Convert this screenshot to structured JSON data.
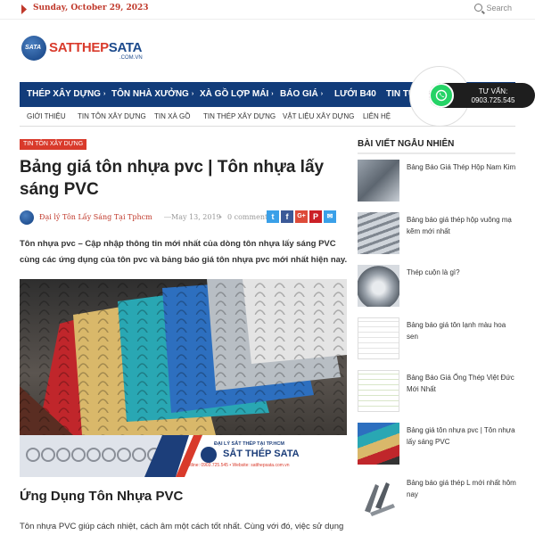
{
  "topbar": {
    "date": "Sunday, October 29, 2023",
    "search_label": "Search"
  },
  "logo": {
    "brand_red": "SATTHEP",
    "brand_blue": "SATA",
    "domain": ".COM.VN",
    "badge": "SATA"
  },
  "nav": {
    "items": [
      {
        "label": "THÉP XÂY DỰNG",
        "chevron": "›"
      },
      {
        "label": "TÔN NHÀ XƯỞNG",
        "chevron": "›"
      },
      {
        "label": "XÀ GỒ LỢP MÁI",
        "chevron": "›"
      },
      {
        "label": "BÁO GIÁ",
        "chevron": "›"
      },
      {
        "label": "LƯỚI B40",
        "chevron": ""
      },
      {
        "label": "TIN TỨC",
        "chevron": "›"
      }
    ],
    "bg_color": "#123c7a"
  },
  "whatsapp": {
    "line1": "TƯ VẤN:",
    "line2": "0903.725.545"
  },
  "subnav": {
    "items": [
      "GIỚI THIỆU",
      "TIN TÔN XÂY DỰNG",
      "TIN XÀ GỒ",
      "TIN THÉP XÂY DỰNG",
      "VẬT LIỆU XÂY DỰNG",
      "LIÊN HỆ"
    ]
  },
  "article": {
    "category": "TIN TÔN XÂY DỰNG",
    "title": "Bảng giá tôn nhựa pvc | Tôn nhựa lấy sáng PVC",
    "author": "Đại lý Tôn Lấy Sáng Tại Tphcm",
    "date": "May 13, 2019",
    "comments": "0 comment",
    "share_icons": [
      "twitter-icon",
      "facebook-icon",
      "googleplus-icon",
      "pinterest-icon",
      "email-icon"
    ],
    "lead": "Tôn nhựa pvc – Cập nhập thông tin mới nhất của dòng tôn nhựa lấy sáng PVC cùng các ứng dụng của tôn pvc và bảng báo giá tôn nhựa pvc mới nhất hiện nay.",
    "banner_line1": "ĐẠI LÝ SẮT THÉP TẠI TP.HCM",
    "banner_line2": "SẮT THÉP SATA",
    "banner_line3": "Hotline: 0903.725.545  •  Website: satthepsata.com.vn",
    "subheading": "Ứng Dụng Tôn Nhựa PVC",
    "body_start": "Tôn nhựa PVC giúp cách nhiệt, cách âm một cách tốt nhất. Cùng với đó, việc sử dụng"
  },
  "sidebar": {
    "title": "BÀI VIẾT NGẪU NHIÊN",
    "items": [
      {
        "text": "Bảng Báo Giá Thép Hộp Nam Kim"
      },
      {
        "text": "Bảng báo giá thép hộp vuông mạ kẽm mới nhất"
      },
      {
        "text": "Thép cuộn là gì?"
      },
      {
        "text": "Bảng báo giá tôn lạnh màu hoa sen"
      },
      {
        "text": "Bảng Báo Giá Ống Thép Việt Đức Mới Nhất"
      },
      {
        "text": "Bảng giá tôn nhựa pvc | Tôn nhựa lấy sáng PVC"
      },
      {
        "text": "Bảng báo giá thép L mới nhất hôm nay"
      }
    ]
  }
}
